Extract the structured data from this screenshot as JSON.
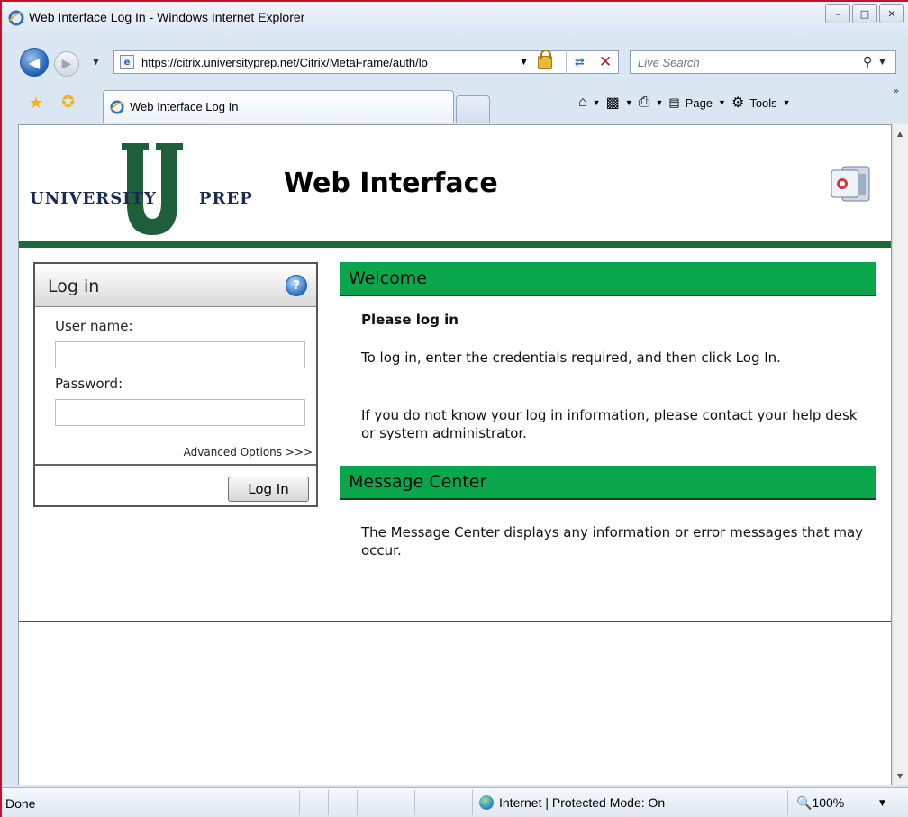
{
  "window": {
    "title": "Web Interface Log In - Windows Internet Explorer",
    "minimize": "–",
    "maximize": "□",
    "close": "✕"
  },
  "address": {
    "url": "https://citrix.universityprep.net/Citrix/MetaFrame/auth/lo",
    "search_placeholder": "Live Search"
  },
  "tab": {
    "label": "Web Interface Log In"
  },
  "command_bar": {
    "page": "Page",
    "tools": "Tools"
  },
  "page": {
    "logo_left": "UNIVERSITY",
    "logo_right": "PREP",
    "logo_letter": "U",
    "app_title": "Web Interface"
  },
  "login": {
    "title": "Log in",
    "username_label": "User name:",
    "password_label": "Password:",
    "advanced": "Advanced Options >>>",
    "button": "Log In"
  },
  "welcome": {
    "heading": "Welcome",
    "subheading": "Please log in",
    "p1": "To log in, enter the credentials required, and then click Log In.",
    "p2": "If you do not know your log in information, please contact your help desk or system administrator."
  },
  "message_center": {
    "heading": "Message Center",
    "text": "The Message Center displays any information or error messages that may occur."
  },
  "status": {
    "left": "Done",
    "zone": "Internet | Protected Mode: On",
    "zoom": "100%"
  },
  "colors": {
    "brand_green": "#0aa64c",
    "rule_green": "#1e6b3a",
    "logo_navy": "#1a2a55",
    "frame_red": "#c8102e"
  }
}
